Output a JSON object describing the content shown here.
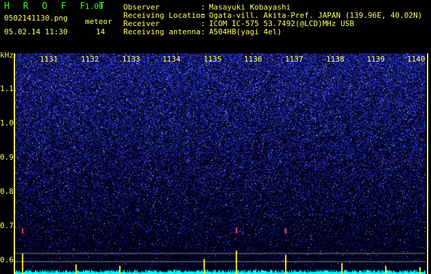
{
  "header": {
    "title": "H R O F F T",
    "version": "1.00",
    "filename": "0502141130.png",
    "datetime": "05.02.14 11:30",
    "meteor_label": "meteor",
    "meteor_count": "14"
  },
  "info": [
    {
      "key": "Observer",
      "value": "Masayuki Kobayashi"
    },
    {
      "key": "Receiving Location",
      "value": "Ogata-vill. Akita-Pref. JAPAN (139.96E, 40.02N)"
    },
    {
      "key": "Receiver",
      "value": "ICOM IC-575 53.7492(@LCD)MHz USB"
    },
    {
      "key": "Receiving antenna",
      "value": "A504HB(yagi 4el)"
    }
  ],
  "plot": {
    "y_unit": "kHz",
    "y_ticks": [
      "1.1",
      "1.0",
      "0.9",
      "0.8",
      "0.7",
      "0.6"
    ],
    "x_ticks": [
      "1131",
      "1132",
      "1133",
      "1134",
      "1135",
      "1136",
      "1137",
      "1138",
      "1139",
      "1140"
    ],
    "colors": {
      "background": "#00001a",
      "noise": "#2233cc",
      "axis": "#ffff66",
      "spectrum": "#00ffff",
      "echo": "#ff4444"
    }
  }
}
